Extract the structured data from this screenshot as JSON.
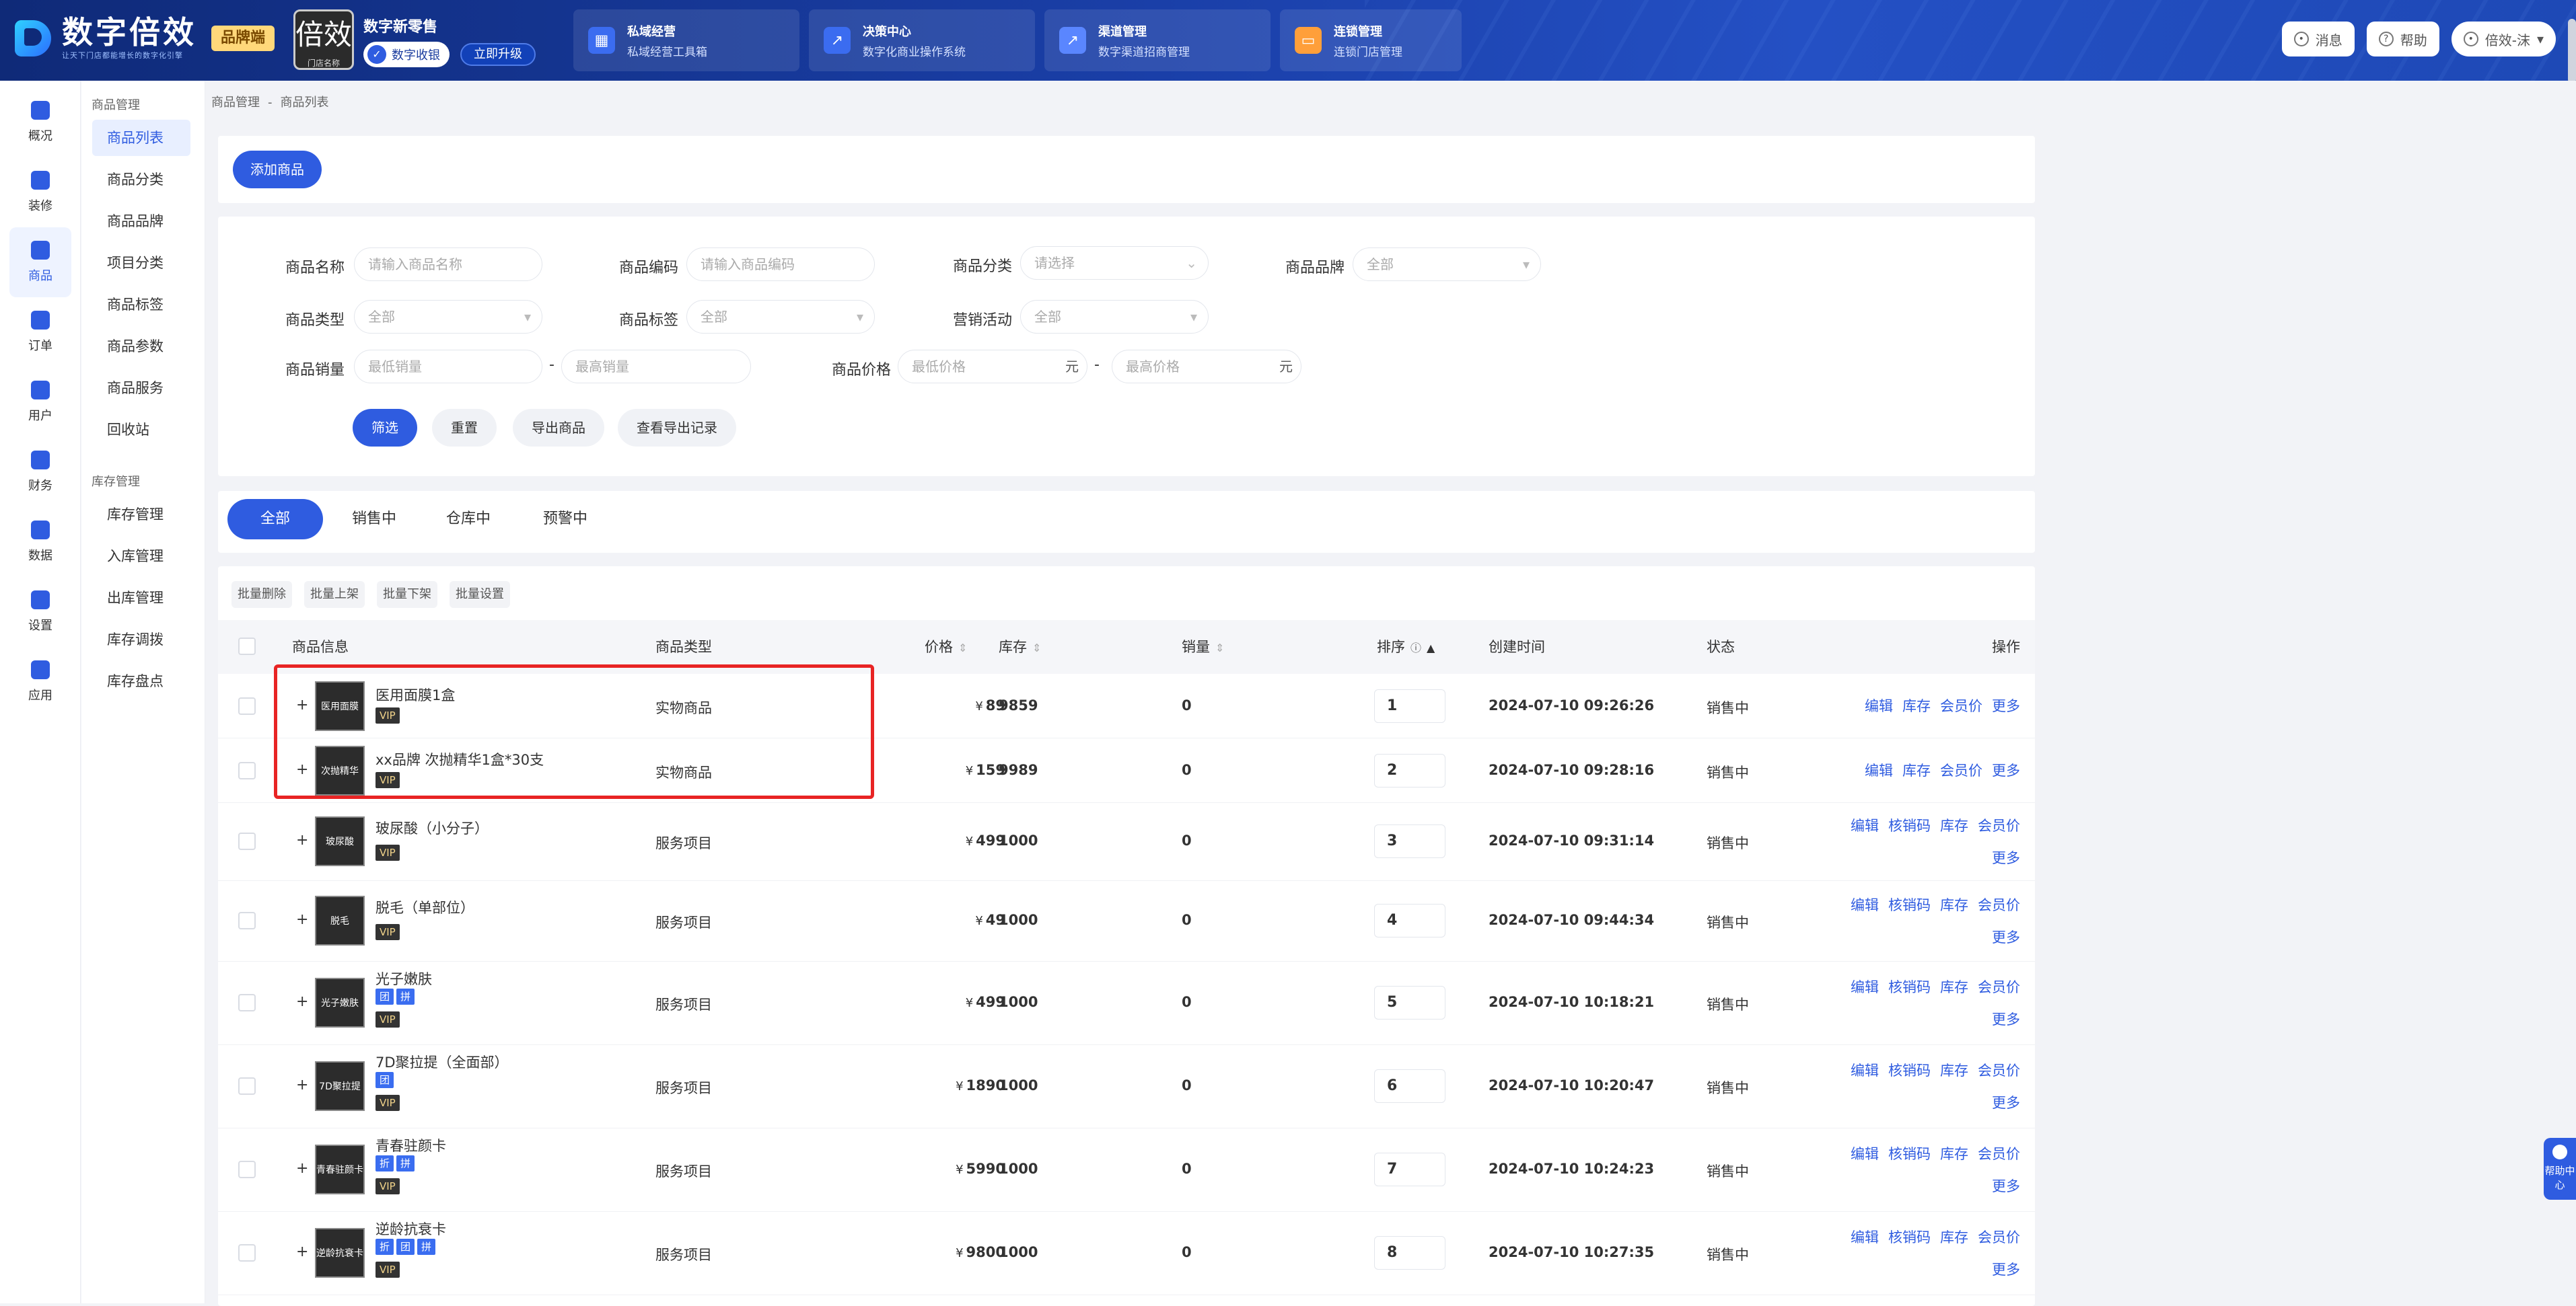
{
  "header": {
    "logo_text": "数字倍效",
    "logo_sub": "让天下门店都能增长的数字化引擎",
    "brand_tag": "品牌端",
    "shop_avatar_text": "倍效",
    "shop_avatar_sub": "门店名称",
    "shop_name": "数字新零售",
    "cashier_label": "数字收银",
    "upgrade_label": "立即升级",
    "nav_cards": [
      {
        "title": "私域经营",
        "subtitle": "私域经营工具箱",
        "icon": "grid-icon"
      },
      {
        "title": "决策中心",
        "subtitle": "数字化商业操作系统",
        "icon": "chart-icon"
      },
      {
        "title": "渠道管理",
        "subtitle": "数字渠道招商管理",
        "icon": "channel-icon"
      },
      {
        "title": "连锁管理",
        "subtitle": "连锁门店管理",
        "icon": "store-icon"
      }
    ],
    "messages_label": "消息",
    "help_label": "帮助",
    "user_label": "倍效-沫"
  },
  "rail": [
    {
      "label": "概况",
      "icon": "overview-icon",
      "active": false
    },
    {
      "label": "装修",
      "icon": "decorate-icon",
      "active": false
    },
    {
      "label": "商品",
      "icon": "goods-icon",
      "active": true
    },
    {
      "label": "订单",
      "icon": "order-icon",
      "active": false
    },
    {
      "label": "用户",
      "icon": "user-icon",
      "active": false
    },
    {
      "label": "财务",
      "icon": "finance-icon",
      "active": false
    },
    {
      "label": "数据",
      "icon": "data-icon",
      "active": false
    },
    {
      "label": "设置",
      "icon": "settings-icon",
      "active": false
    },
    {
      "label": "应用",
      "icon": "apps-icon",
      "active": false
    }
  ],
  "subnav": {
    "group1_title": "商品管理",
    "group1": [
      "商品列表",
      "商品分类",
      "商品品牌",
      "项目分类",
      "商品标签",
      "商品参数",
      "商品服务",
      "回收站"
    ],
    "group2_title": "库存管理",
    "group2": [
      "库存管理",
      "入库管理",
      "出库管理",
      "库存调拨",
      "库存盘点"
    ]
  },
  "breadcrumb": {
    "parent": "商品管理",
    "sep": "-",
    "current": "商品列表"
  },
  "add_button": "添加商品",
  "filters": {
    "name_label": "商品名称",
    "name_placeholder": "请输入商品名称",
    "code_label": "商品编码",
    "code_placeholder": "请输入商品编码",
    "category_label": "商品分类",
    "category_placeholder": "请选择",
    "brand_label": "商品品牌",
    "brand_value": "全部",
    "type_label": "商品类型",
    "type_value": "全部",
    "tag_label": "商品标签",
    "tag_value": "全部",
    "marketing_label": "营销活动",
    "marketing_value": "全部",
    "sales_label": "商品销量",
    "sales_min": "最低销量",
    "sales_max": "最高销量",
    "price_label": "商品价格",
    "price_min": "最低价格",
    "price_max": "最高价格",
    "unit": "元",
    "dash": "-",
    "btn_filter": "筛选",
    "btn_reset": "重置",
    "btn_export": "导出商品",
    "btn_export_log": "查看导出记录"
  },
  "tabs": [
    "全部",
    "销售中",
    "仓库中",
    "预警中"
  ],
  "bulk_actions": [
    "批量删除",
    "批量上架",
    "批量下架",
    "批量设置"
  ],
  "columns": {
    "info": "商品信息",
    "type": "商品类型",
    "price": "价格",
    "stock": "库存",
    "sales": "销量",
    "sort": "排序",
    "created": "创建时间",
    "status": "状态",
    "ops": "操作"
  },
  "op_labels": {
    "edit": "编辑",
    "verify": "核销码",
    "stock": "库存",
    "member_price": "会员价",
    "more": "更多"
  },
  "products": [
    {
      "thumb": "医用面膜",
      "name": "医用面膜1盒",
      "tags": [
        "VIP"
      ],
      "type": "实物商品",
      "currency": "¥",
      "price": "89",
      "stock": "9859",
      "sales": "0",
      "sort": "1",
      "created": "2024-07-10 09:26:26",
      "status": "销售中"
    },
    {
      "thumb": "次抛精华",
      "name": "xx品牌 次抛精华1盒*30支",
      "tags": [
        "VIP"
      ],
      "type": "实物商品",
      "currency": "¥",
      "price": "159",
      "stock": "9989",
      "sales": "0",
      "sort": "2",
      "created": "2024-07-10 09:28:16",
      "status": "销售中"
    },
    {
      "thumb": "玻尿酸",
      "name": "玻尿酸（小分子）",
      "tags": [
        "VIP"
      ],
      "type": "服务项目",
      "currency": "¥",
      "price": "499",
      "stock": "1000",
      "sales": "0",
      "sort": "3",
      "created": "2024-07-10 09:31:14",
      "status": "销售中"
    },
    {
      "thumb": "脱毛",
      "name": "脱毛（单部位）",
      "tags": [
        "VIP"
      ],
      "type": "服务项目",
      "currency": "¥",
      "price": "49",
      "stock": "1000",
      "sales": "0",
      "sort": "4",
      "created": "2024-07-10 09:44:34",
      "status": "销售中"
    },
    {
      "thumb": "光子嫩肤",
      "name": "光子嫩肤",
      "tags": [
        "团",
        "拼",
        "VIP"
      ],
      "type": "服务项目",
      "currency": "¥",
      "price": "499",
      "stock": "1000",
      "sales": "0",
      "sort": "5",
      "created": "2024-07-10 10:18:21",
      "status": "销售中"
    },
    {
      "thumb": "7D聚拉提",
      "name": "7D聚拉提（全面部）",
      "tags": [
        "团",
        "VIP"
      ],
      "type": "服务项目",
      "currency": "¥",
      "price": "1890",
      "stock": "1000",
      "sales": "0",
      "sort": "6",
      "created": "2024-07-10 10:20:47",
      "status": "销售中"
    },
    {
      "thumb": "青春驻颜卡",
      "name": "青春驻颜卡",
      "tags": [
        "折",
        "拼",
        "VIP"
      ],
      "type": "服务项目",
      "currency": "¥",
      "price": "5990",
      "stock": "1000",
      "sales": "0",
      "sort": "7",
      "created": "2024-07-10 10:24:23",
      "status": "销售中"
    },
    {
      "thumb": "逆龄抗衰卡",
      "name": "逆龄抗衰卡",
      "tags": [
        "折",
        "团",
        "拼",
        "VIP"
      ],
      "type": "服务项目",
      "currency": "¥",
      "price": "9800",
      "stock": "1000",
      "sales": "0",
      "sort": "8",
      "created": "2024-07-10 10:27:35",
      "status": "销售中"
    }
  ],
  "help_fab": "帮助中心"
}
